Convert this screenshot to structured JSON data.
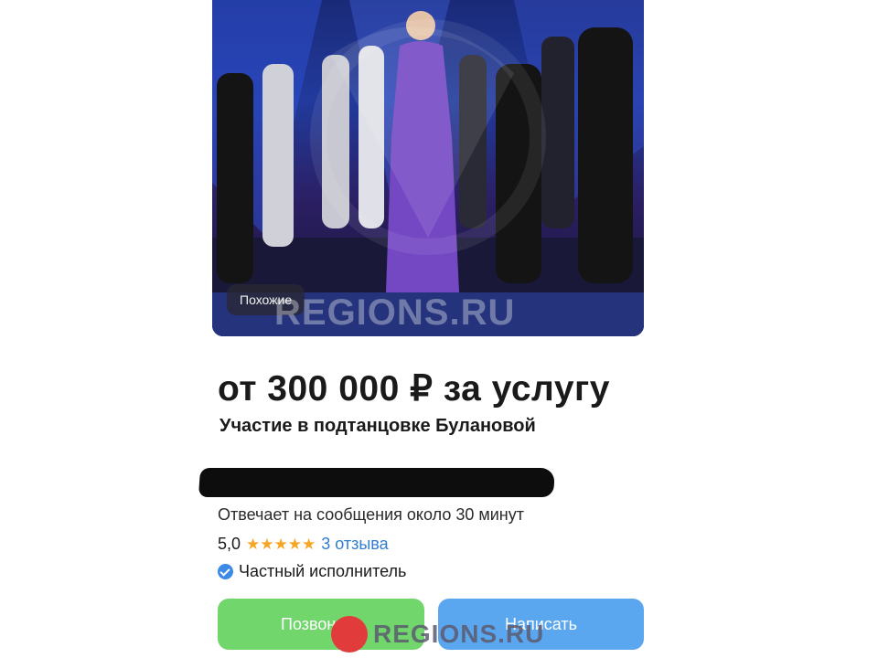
{
  "photo": {
    "similar_label": "Похожие",
    "watermark": "REGIONS.RU"
  },
  "listing": {
    "price": "от 300 000 ₽ за услугу",
    "service_title": "Участие в подтанцовке Булановой"
  },
  "seller": {
    "response_time": "Отвечает на сообщения около 30 минут",
    "rating": "5,0",
    "stars": "★★★★★",
    "reviews": "3 отзыва",
    "type": "Частный исполнитель"
  },
  "actions": {
    "call_label": "Позвонить",
    "write_label": "Написать"
  },
  "watermark_bottom": "REGIONS.RU",
  "colors": {
    "call_button": "#71d66c",
    "write_button": "#5aa7f0",
    "reviews_link": "#2f7dd1",
    "stars": "#f5a623"
  }
}
